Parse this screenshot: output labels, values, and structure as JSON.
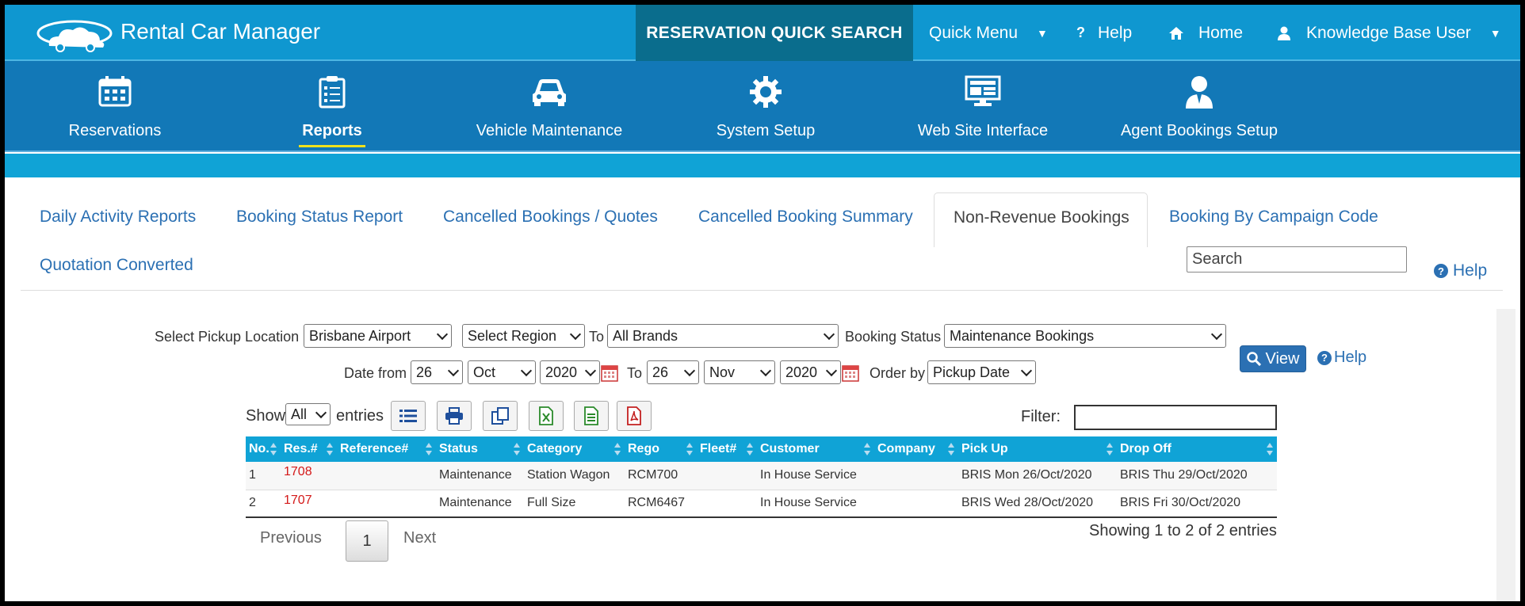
{
  "header": {
    "app_title": "Rental Car Manager",
    "quick_search": "RESERVATION QUICK SEARCH",
    "nav": [
      {
        "label": "Quick Menu",
        "icon": "chevron-down-icon"
      },
      {
        "label": "Help",
        "icon": "question-icon"
      },
      {
        "label": "Home",
        "icon": "home-icon"
      },
      {
        "label": "Knowledge Base User",
        "icon": "user-icon"
      }
    ],
    "brand_color": "#0f97d0",
    "active_color": "#0a6d8d"
  },
  "modules": [
    {
      "label": "Reservations",
      "icon": "calendar-icon"
    },
    {
      "label": "Reports",
      "icon": "clipboard-icon",
      "active": true
    },
    {
      "label": "Vehicle Maintenance",
      "icon": "car-icon"
    },
    {
      "label": "System Setup",
      "icon": "gear-icon"
    },
    {
      "label": "Web Site Interface",
      "icon": "monitor-icon"
    },
    {
      "label": "Agent Bookings Setup",
      "icon": "agent-icon"
    }
  ],
  "subtabs": [
    "Daily Activity Reports",
    "Booking Status Report",
    "Cancelled Bookings / Quotes",
    "Cancelled Booking Summary",
    "Non-Revenue Bookings",
    "Booking By Campaign Code",
    "Quotation Converted"
  ],
  "search": {
    "placeholder": "Search"
  },
  "help_label": "Help",
  "filters": {
    "pickup_label": "Select Pickup Location",
    "pickup_value": "Brisbane Airport",
    "region_value": "Select Region",
    "to_label": "To",
    "brand_value": "All Brands",
    "status_label": "Booking Status",
    "status_value": "Maintenance Bookings",
    "date_from_label": "Date from",
    "from_day": "26",
    "from_month": "Oct",
    "from_year": "2020",
    "to_day": "26",
    "to_month": "Nov",
    "to_year": "2020",
    "order_label": "Order by",
    "order_value": "Pickup Date",
    "view_label": "View",
    "help_label": "Help"
  },
  "table_controls": {
    "show_label": "Show",
    "show_value": "All",
    "entries_label": "entries",
    "filter_label": "Filter:",
    "tool_icons": [
      "list-icon",
      "print-icon",
      "copy-icon",
      "excel-icon",
      "csv-icon",
      "pdf-icon"
    ]
  },
  "table": {
    "columns": [
      "No.",
      "Res.#",
      "Reference#",
      "Status",
      "Category",
      "Rego",
      "Fleet#",
      "Customer",
      "Company",
      "Pick Up",
      "Drop Off"
    ],
    "rows": [
      {
        "no": "1",
        "res": "1708",
        "ref": "",
        "status": "Maintenance",
        "category": "Station Wagon",
        "rego": "RCM700",
        "fleet": "",
        "customer": "In House Service",
        "company": "",
        "pickup": "BRIS Mon 26/Oct/2020",
        "dropoff": "BRIS Thu 29/Oct/2020"
      },
      {
        "no": "2",
        "res": "1707",
        "ref": "",
        "status": "Maintenance",
        "category": "Full Size",
        "rego": "RCM6467",
        "fleet": "",
        "customer": "In House Service",
        "company": "",
        "pickup": "BRIS Wed 28/Oct/2020",
        "dropoff": "BRIS Fri 30/Oct/2020"
      }
    ]
  },
  "pagination": {
    "previous": "Previous",
    "page": "1",
    "next": "Next",
    "info": "Showing 1 to 2 of 2 entries"
  }
}
